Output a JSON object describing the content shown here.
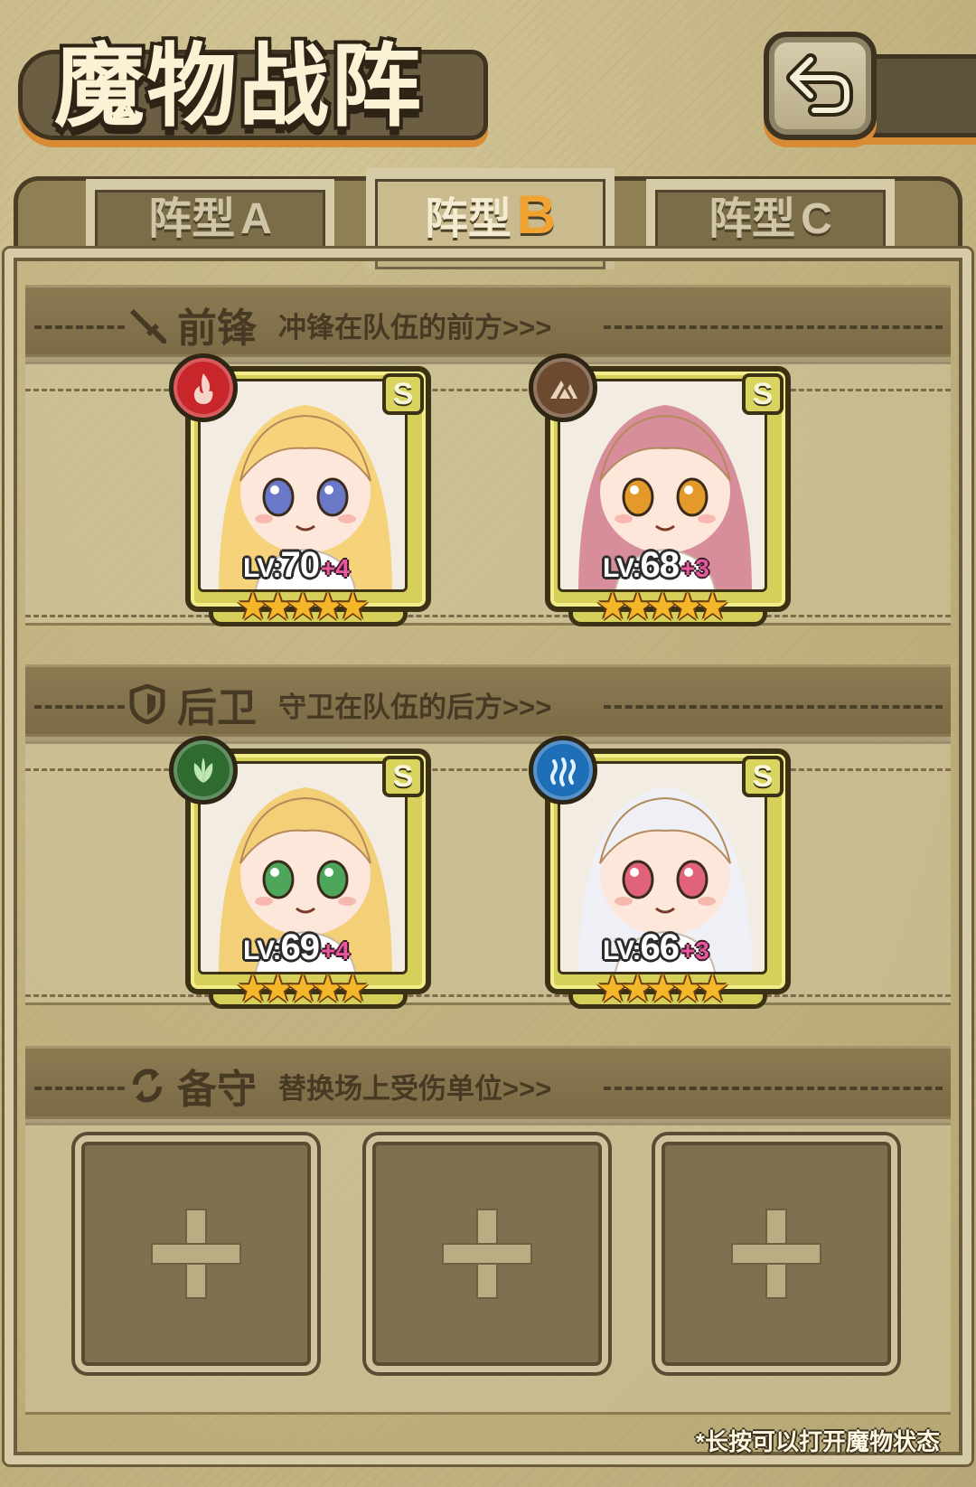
{
  "header": {
    "title": "魔物战阵",
    "back_icon": "return-arrow-icon"
  },
  "tabs": [
    {
      "label": "阵型",
      "letter": "A",
      "active": false
    },
    {
      "label": "阵型",
      "letter": "B",
      "active": true
    },
    {
      "label": "阵型",
      "letter": "C",
      "active": false
    }
  ],
  "sections": {
    "front": {
      "title": "前锋",
      "subtitle": "冲锋在队伍的前方>>>",
      "icon": "sword-icon"
    },
    "back": {
      "title": "后卫",
      "subtitle": "守卫在队伍的后方>>>",
      "icon": "shield-icon"
    },
    "reserve": {
      "title": "备守",
      "subtitle": "替换场上受伤单位>>>",
      "icon": "swap-arrows-icon"
    }
  },
  "front_cards": [
    {
      "rarity": "S",
      "element": "fire-icon",
      "element_color": "#c8262b",
      "level_prefix": "LV:",
      "level": "70",
      "bonus": "+4",
      "stars": 5,
      "hair_color": "#f6d37a",
      "eye_color": "#6a78c8"
    },
    {
      "rarity": "S",
      "element": "earth-icon",
      "element_color": "#6b4a30",
      "level_prefix": "LV:",
      "level": "68",
      "bonus": "+3",
      "stars": 5,
      "hair_color": "#d78e9a",
      "eye_color": "#e39a2a"
    }
  ],
  "back_cards": [
    {
      "rarity": "S",
      "element": "leaf-icon",
      "element_color": "#2f6b2f",
      "level_prefix": "LV:",
      "level": "69",
      "bonus": "+4",
      "stars": 5,
      "hair_color": "#f3cf78",
      "eye_color": "#4ea65a"
    },
    {
      "rarity": "S",
      "element": "water-icon",
      "element_color": "#1f6fb8",
      "level_prefix": "LV:",
      "level": "66",
      "bonus": "+3",
      "stars": 5,
      "hair_color": "#eef0f6",
      "eye_color": "#e0637a"
    }
  ],
  "reserve_slots": [
    "empty",
    "empty",
    "empty"
  ],
  "footer_note": "*长按可以打开魔物状态",
  "colors": {
    "accent_orange": "#d88a35",
    "card_gold": "#d6d05b",
    "bonus_pink": "#e8589c",
    "active_tab_letter": "#f1a332"
  }
}
